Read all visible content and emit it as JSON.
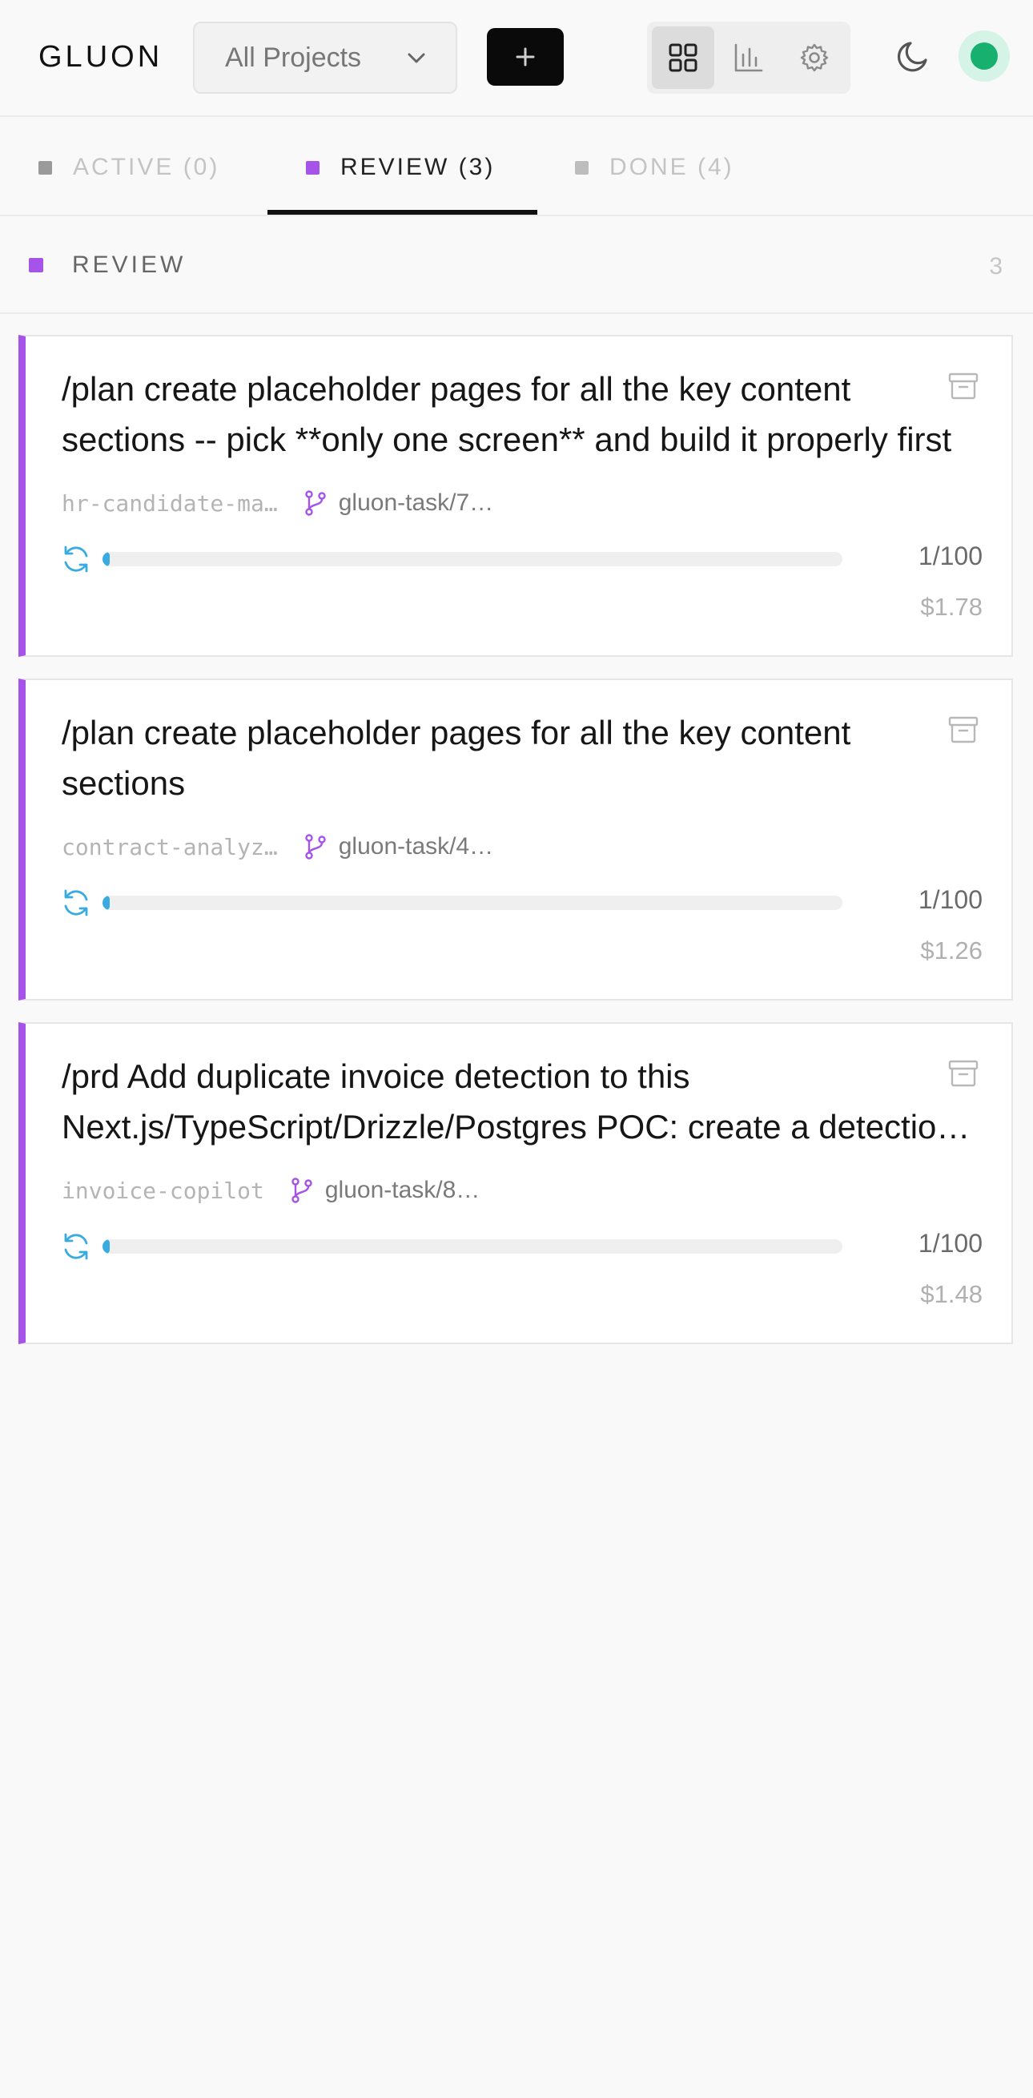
{
  "header": {
    "logo": "GLUON",
    "project_select": "All Projects",
    "new_button": "+"
  },
  "tabs": [
    {
      "label": "ACTIVE (0)",
      "color": "#9a9a9a",
      "active": false
    },
    {
      "label": "REVIEW (3)",
      "color": "#a553e8",
      "active": true
    },
    {
      "label": "DONE (4)",
      "color": "#bdbdbd",
      "active": false
    }
  ],
  "section": {
    "title": "REVIEW",
    "count": "3",
    "color": "#a553e8"
  },
  "cards": [
    {
      "title": "/plan create placeholder pages for all the key content sections -- pick **only one screen** and build it properly first",
      "project": "hr-candidate-ma…",
      "branch": "gluon-task/7…",
      "progress_label": "1/100",
      "progress": 0.01,
      "cost": "$1.78"
    },
    {
      "title": "/plan create placeholder pages for all the key content sections",
      "project": "contract-analyz…",
      "branch": "gluon-task/4…",
      "progress_label": "1/100",
      "progress": 0.01,
      "cost": "$1.26"
    },
    {
      "title": "/prd Add duplicate invoice detection to this Next.js/TypeScript/Drizzle/Postgres POC: create a detection service",
      "project": "invoice-copilot",
      "branch": "gluon-task/8…",
      "progress_label": "1/100",
      "progress": 0.01,
      "cost": "$1.48"
    }
  ],
  "colors": {
    "accent": "#a553e8",
    "progress": "#3aabe0",
    "status_online": "#18b06f"
  }
}
